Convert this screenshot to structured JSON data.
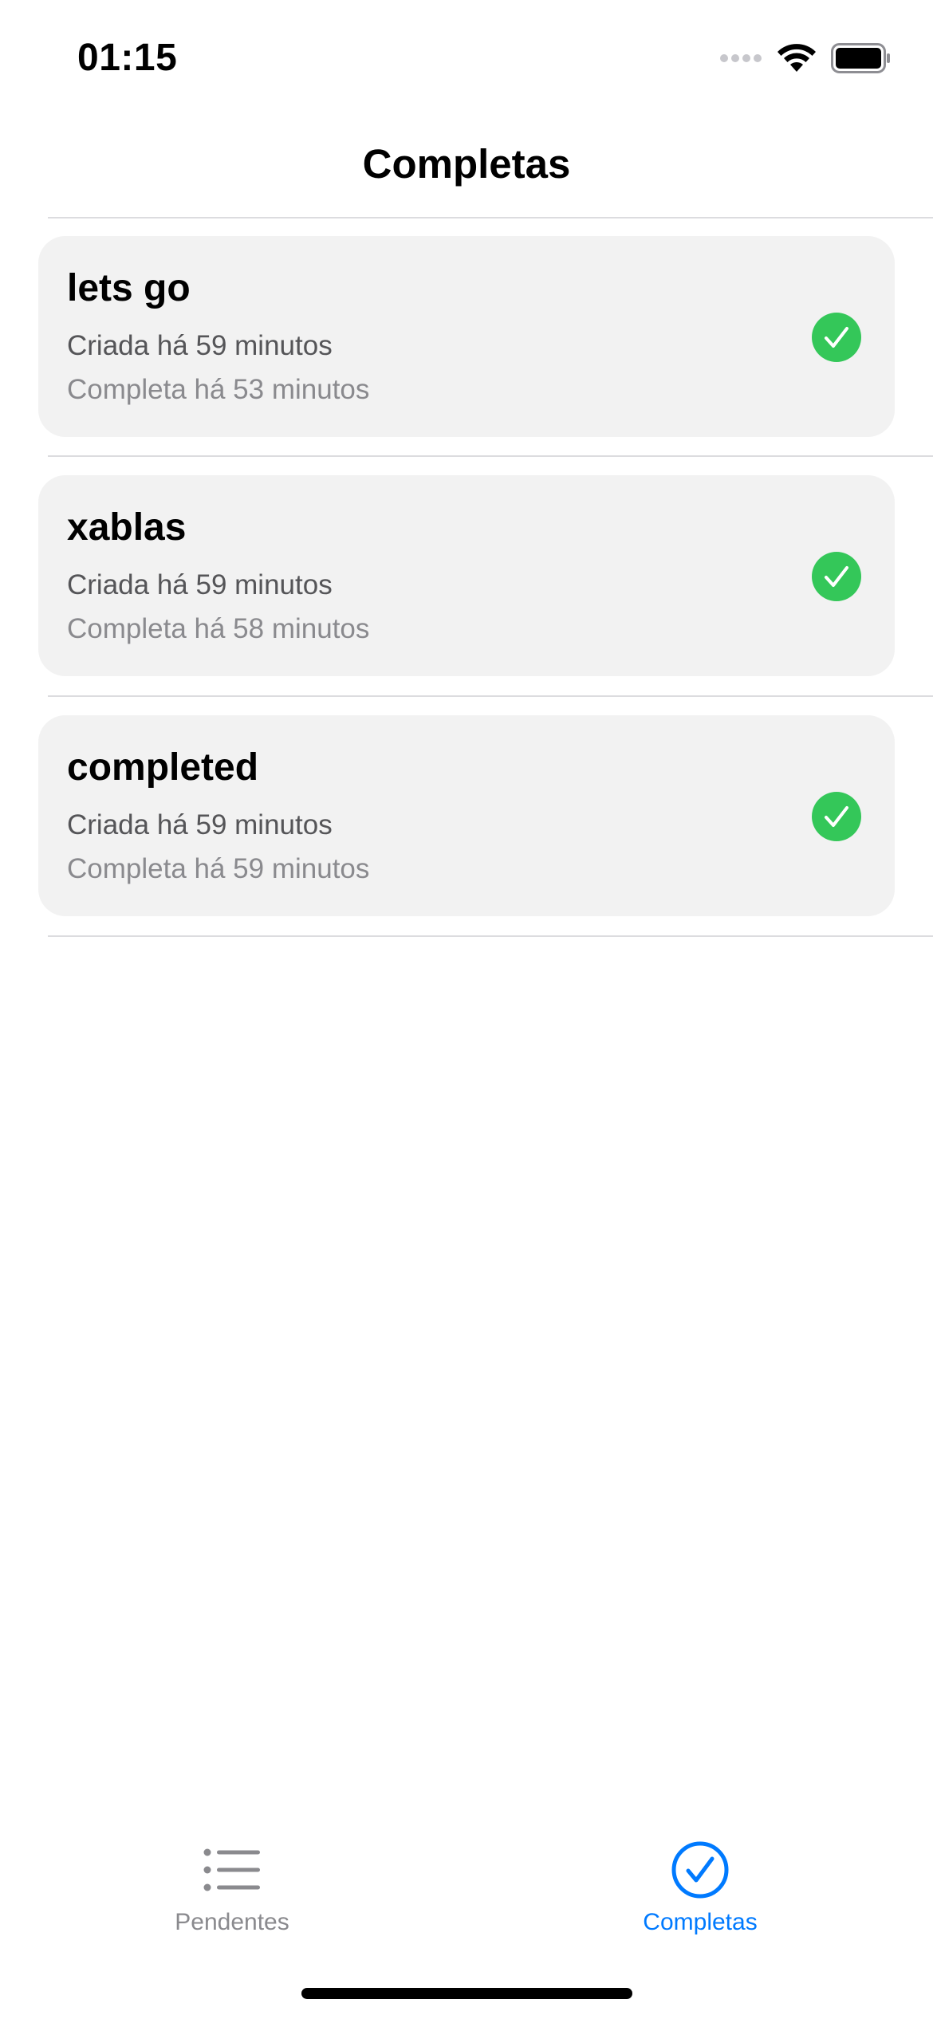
{
  "status_bar": {
    "time": "01:15",
    "signal_icon": "signal-dots-icon",
    "wifi_icon": "wifi-icon",
    "battery_icon": "battery-icon"
  },
  "nav": {
    "title": "Completas"
  },
  "tasks": [
    {
      "title": "lets go",
      "created": "Criada há 59 minutos",
      "completed": "Completa há 53 minutos",
      "status_icon": "checkmark-circle-icon"
    },
    {
      "title": "xablas",
      "created": "Criada há 59 minutos",
      "completed": "Completa há 58 minutos",
      "status_icon": "checkmark-circle-icon"
    },
    {
      "title": "completed",
      "created": "Criada há 59 minutos",
      "completed": "Completa há 59 minutos",
      "status_icon": "checkmark-circle-icon"
    }
  ],
  "tab_bar": {
    "tabs": [
      {
        "label": "Pendentes",
        "icon": "list-icon",
        "selected": false
      },
      {
        "label": "Completas",
        "icon": "checkmark-circle-icon",
        "selected": true
      }
    ]
  },
  "colors": {
    "accent": "#007aff",
    "success": "#34c759",
    "card_background": "#f2f2f2",
    "secondary_text": "#8a8a8e"
  }
}
